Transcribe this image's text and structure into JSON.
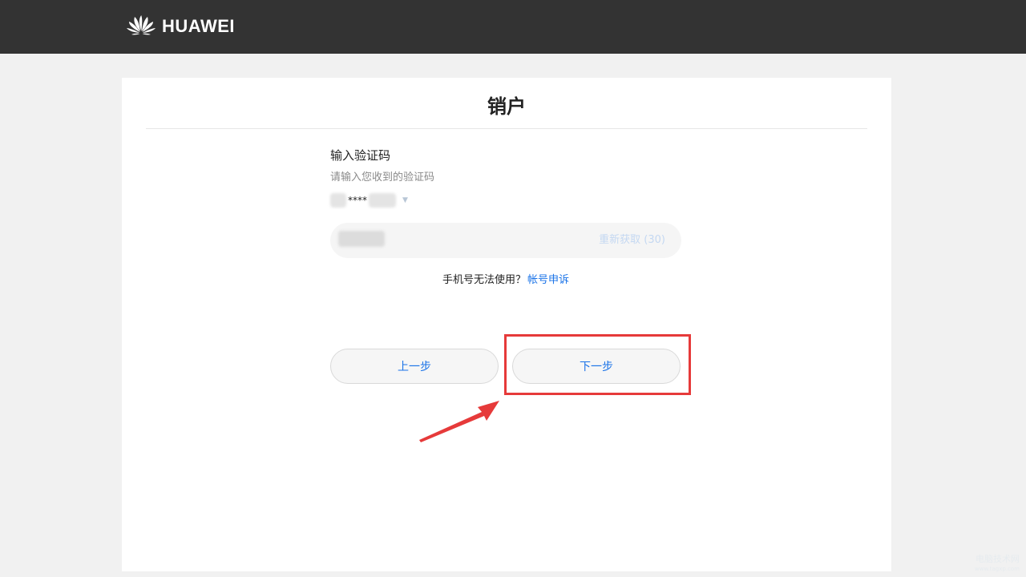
{
  "header": {
    "brand": "HUAWEI",
    "logo_icon": "huawei-flower-logo",
    "bg_color": "#333333"
  },
  "card": {
    "title": "销户"
  },
  "form": {
    "step_title": "输入验证码",
    "step_hint": "请输入您收到的验证码",
    "phone_masked": "****",
    "code_input_value": "",
    "resend_label": "重新获取 (30)",
    "help_text": "手机号无法使用？",
    "help_link": "帐号申诉"
  },
  "buttons": {
    "prev_label": "上一步",
    "next_label": "下一步"
  },
  "watermark": {
    "line1": "电脑技术网",
    "line2": "www.tagxp.com"
  },
  "colors": {
    "accent": "#1a73e8",
    "annotation": "#e63a3a"
  }
}
